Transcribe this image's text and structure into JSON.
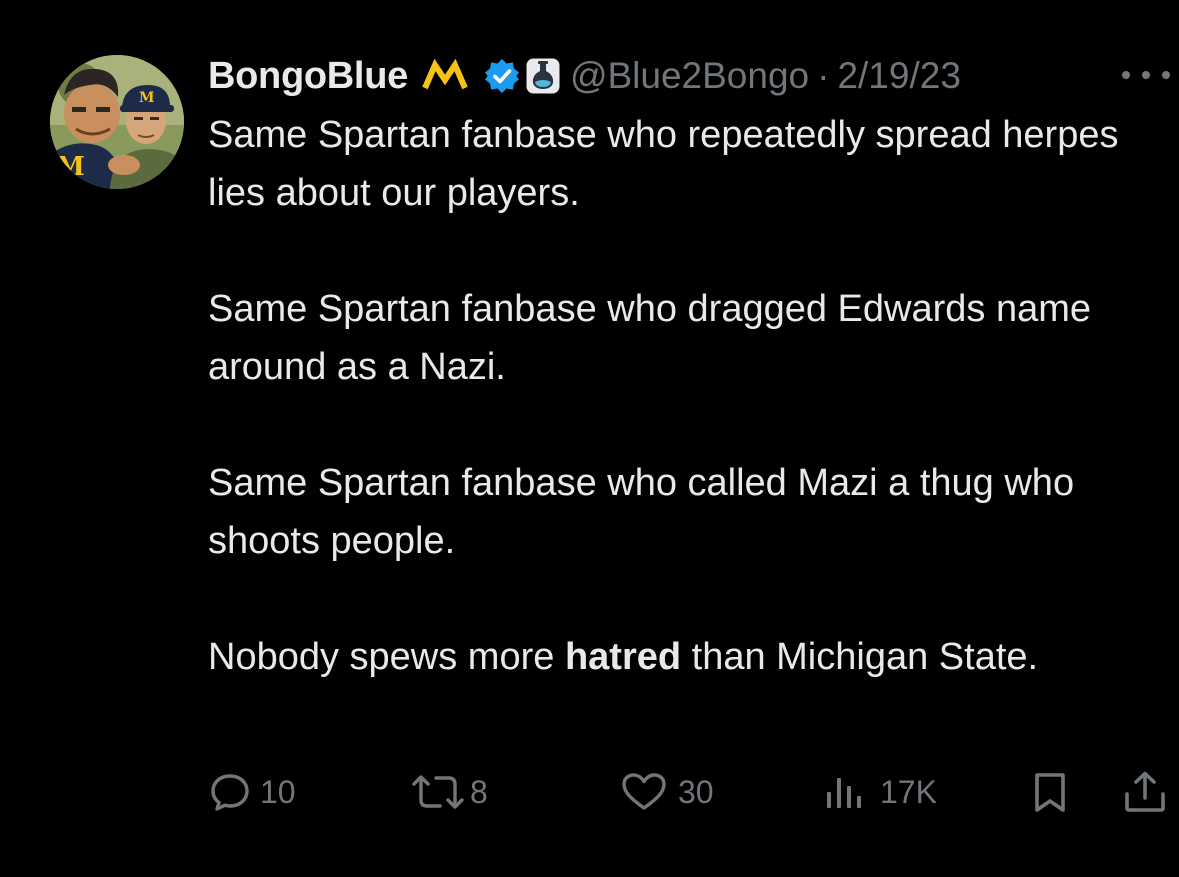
{
  "tweet": {
    "author": {
      "display_name": "BongoBlue",
      "handle": "@Blue2Bongo",
      "avatar_icon": "cartoon-michigan-fans-avatar"
    },
    "badges": [
      {
        "icon": "michigan-m-badge-icon",
        "color": "#f5c318"
      },
      {
        "icon": "verified-check-icon",
        "color": "#1d9bf0"
      },
      {
        "icon": "affiliate-flask-icon",
        "color": "#7f8c99"
      }
    ],
    "separator": "·",
    "date": "2/19/23",
    "body": {
      "p1": "Same Spartan fanbase who repeatedly spread herpes lies about our players.",
      "p2": "Same Spartan fanbase who dragged Edwards name around as a Nazi.",
      "p3": "Same Spartan fanbase who called Mazi a thug who shoots people.",
      "p4_before": "Nobody spews more ",
      "p4_bold": "hatred",
      "p4_after": " than Michigan State."
    },
    "actions": {
      "replies": "10",
      "retweets": "8",
      "likes": "30",
      "views": "17K"
    }
  },
  "colors": {
    "background": "#000000",
    "text_primary": "#e7e9ea",
    "text_secondary": "#71767b",
    "verified": "#1d9bf0",
    "michigan_maize": "#f5c318"
  }
}
